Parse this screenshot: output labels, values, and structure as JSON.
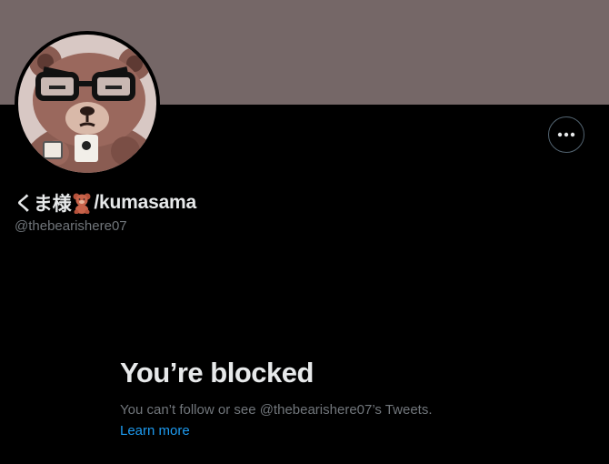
{
  "profile": {
    "display_name_prefix": "くま様",
    "display_name_emoji": "teddy-bear-emoji",
    "display_name_suffix": "/kumasama",
    "handle": "@thebearishere07",
    "banner_color": "#756767",
    "avatar_icon": "bear-with-glasses-avatar",
    "more_icon": "more-horizontal-icon"
  },
  "blocked_notice": {
    "title": "You’re blocked",
    "description": "You can’t follow or see @thebearishere07’s Tweets.",
    "link_label": "Learn more",
    "link_color": "#1d9bf0"
  },
  "theme": {
    "background": "#000000",
    "primary_text": "#e7e9ea",
    "secondary_text": "#71767b"
  }
}
